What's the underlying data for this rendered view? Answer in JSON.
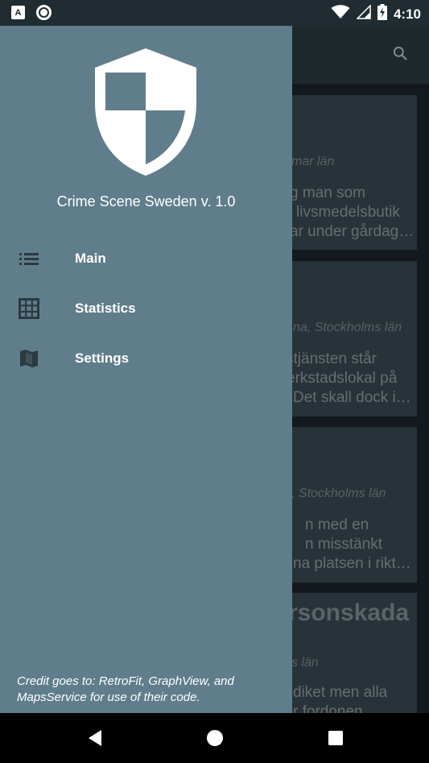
{
  "status_bar": {
    "time": "4:10",
    "left_icons": [
      "a-notification-icon",
      "record-icon"
    ],
    "right_icons": [
      "wifi-icon",
      "signal-icon",
      "battery-charging-icon"
    ]
  },
  "drawer": {
    "app_title": "Crime Scene Sweden v. 1.0",
    "menu": [
      {
        "label": "Main",
        "icon": "list-icon"
      },
      {
        "label": "Statistics",
        "icon": "grid-icon"
      },
      {
        "label": "Settings",
        "icon": "map-icon"
      }
    ],
    "credit": "Credit goes to: RetroFit, GraphView, and MapsService for use of their code."
  },
  "background_feed": {
    "cards": [
      {
        "location": "mar län",
        "lines": [
          "g man som",
          "livsmedelsbutik",
          "ar under gårdag…"
        ]
      },
      {
        "location": "na, Stockholms län",
        "lines": [
          "stjänsten står",
          "erkstadslokal på",
          "Det skall dock i…"
        ]
      },
      {
        "location": ", Stockholms län",
        "lines": [
          "n med en",
          "n misstänkt",
          "na platsen i rikt…"
        ]
      },
      {
        "title": "rsonskada",
        "location": "s län",
        "lines": [
          "diket men alla",
          "r fordonen"
        ]
      }
    ]
  },
  "colors": {
    "drawer_bg": "#607d8b",
    "status_bar_bg": "#202c31",
    "card_bg": "#37474f"
  }
}
